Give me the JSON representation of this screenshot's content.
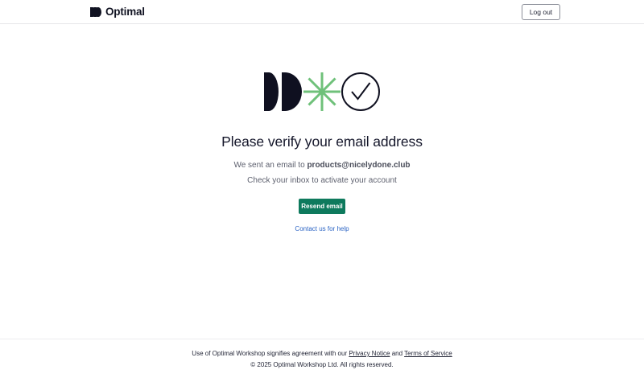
{
  "header": {
    "brand_name": "Optimal",
    "logout_label": "Log out"
  },
  "main": {
    "title": "Please verify your email address",
    "sent_prefix": "We sent an email to ",
    "email": "products@nicelydone.club",
    "check_inbox": "Check your inbox to activate your account",
    "resend_label": "Resend email",
    "help_link": "Contact us for help"
  },
  "footer": {
    "agreement_prefix": "Use of Optimal Workshop signifies agreement with our ",
    "privacy_link": "Privacy Notice",
    "and_text": " and ",
    "terms_link": "Terms of Service",
    "copyright": "© 2025 Optimal Workshop Ltd. All rights reserved."
  },
  "colors": {
    "accent": "#0e7a5d",
    "asterisk": "#6fc17a",
    "link": "#2a63c4",
    "ink": "#14162a"
  },
  "icons": {
    "brand_mark": "optimal-logo-icon",
    "hero_shapes": "double-d-shape-icon",
    "hero_asterisk": "asterisk-icon",
    "hero_check": "check-circle-icon"
  }
}
